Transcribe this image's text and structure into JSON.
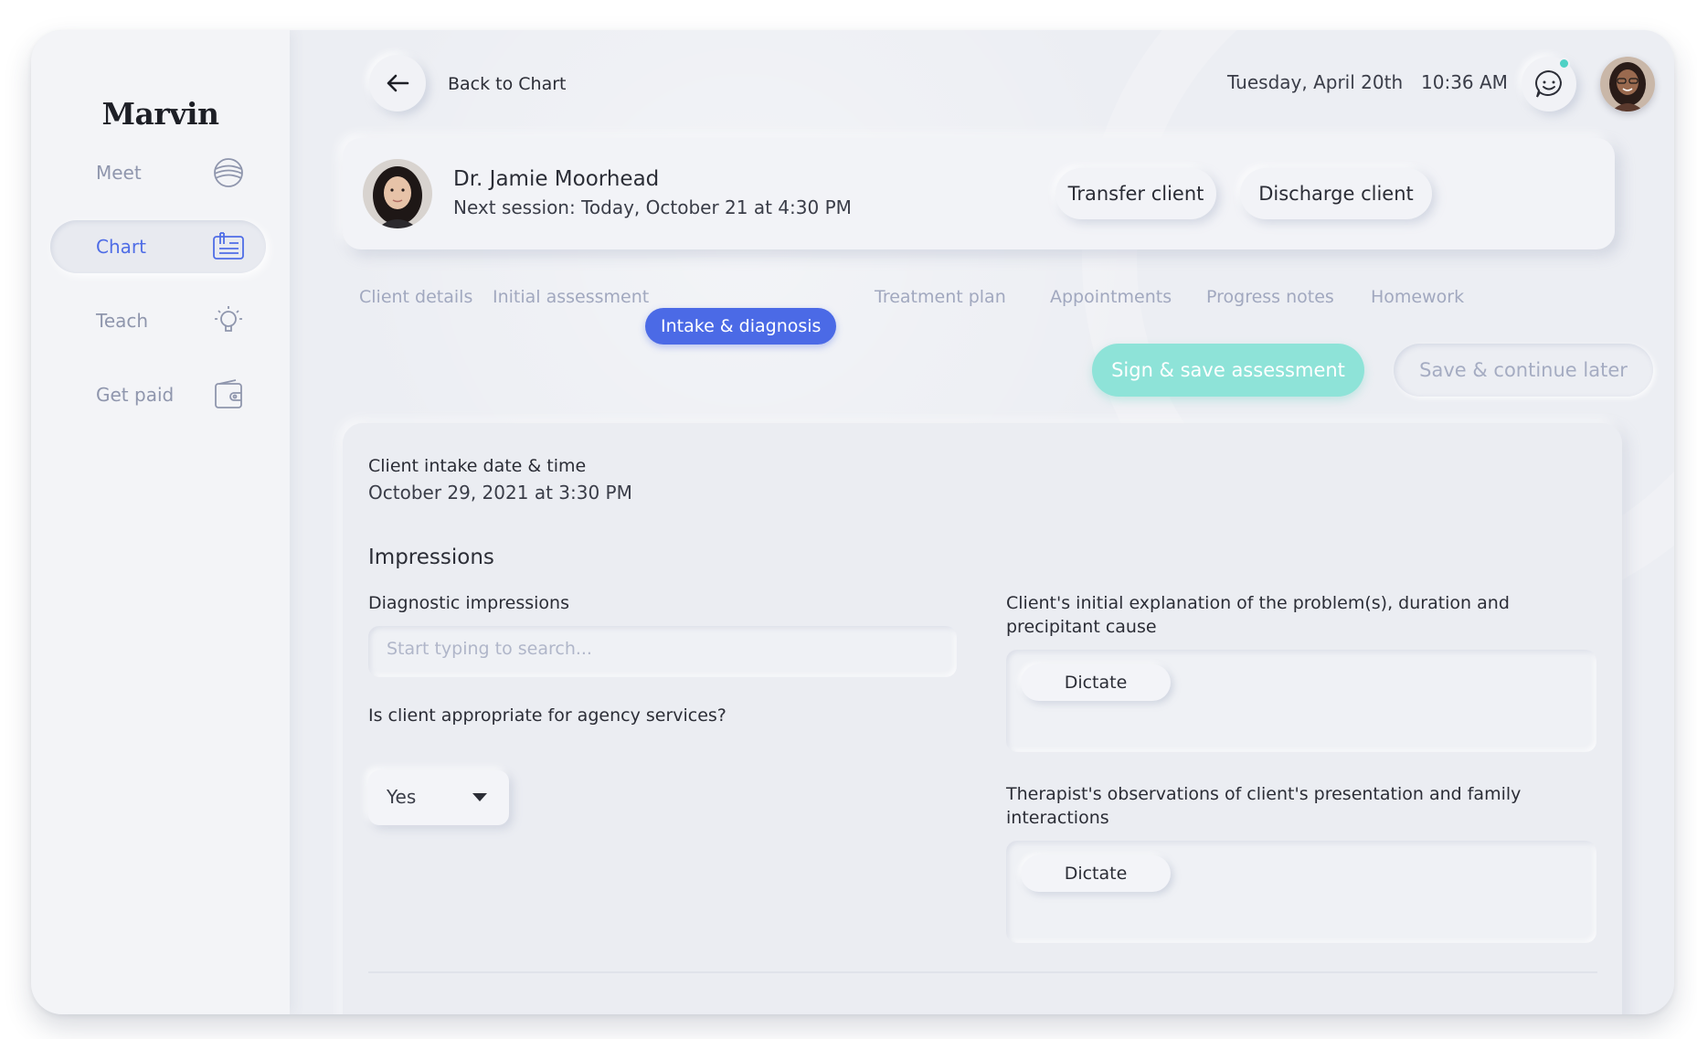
{
  "app": {
    "logo": "Marvin"
  },
  "sidebar": {
    "items": [
      {
        "label": "Meet",
        "icon": "globe-icon",
        "active": false
      },
      {
        "label": "Chart",
        "icon": "clipboard-icon",
        "active": true
      },
      {
        "label": "Teach",
        "icon": "lightbulb-icon",
        "active": false
      },
      {
        "label": "Get paid",
        "icon": "wallet-icon",
        "active": false
      }
    ]
  },
  "header": {
    "back_label": "Back to Chart",
    "date": "Tuesday, April 20th",
    "time": "10:36 AM",
    "chat_icon": "chat-bubble-icon",
    "has_notification": true
  },
  "client_card": {
    "name": "Dr. Jamie Moorhead",
    "next_session": "Next session:  Today,  October 21 at 4:30 PM",
    "transfer_label": "Transfer client",
    "discharge_label": "Discharge client"
  },
  "tabs": [
    {
      "label": "Client details",
      "active": false
    },
    {
      "label": "Initial assessment",
      "active": false
    },
    {
      "label": "Intake  & diagnosis",
      "active": true
    },
    {
      "label": "Treatment plan",
      "active": false
    },
    {
      "label": "Appointments",
      "active": false
    },
    {
      "label": "Progress notes",
      "active": false
    },
    {
      "label": "Homework",
      "active": false
    }
  ],
  "actions": {
    "sign_save": "Sign & save assessment",
    "save_later": "Save & continue later"
  },
  "form": {
    "intake_label": "Client intake date & time",
    "intake_value": "October 29, 2021 at 3:30 PM",
    "impressions_title": "Impressions",
    "diagnostic_label": "Diagnostic impressions",
    "diagnostic_placeholder": "Start typing to search...",
    "appropriate_label": "Is client appropriate for agency services?",
    "appropriate_value": "Yes",
    "explanation_label": "Client's initial explanation of the problem(s), duration and precipitant cause",
    "observations_label": "Therapist's observations of client's presentation and family interactions",
    "dictate_label": "Dictate"
  },
  "colors": {
    "accent": "#4b6ae6",
    "teal": "#8ee3d8",
    "notification": "#4fd1c5"
  }
}
